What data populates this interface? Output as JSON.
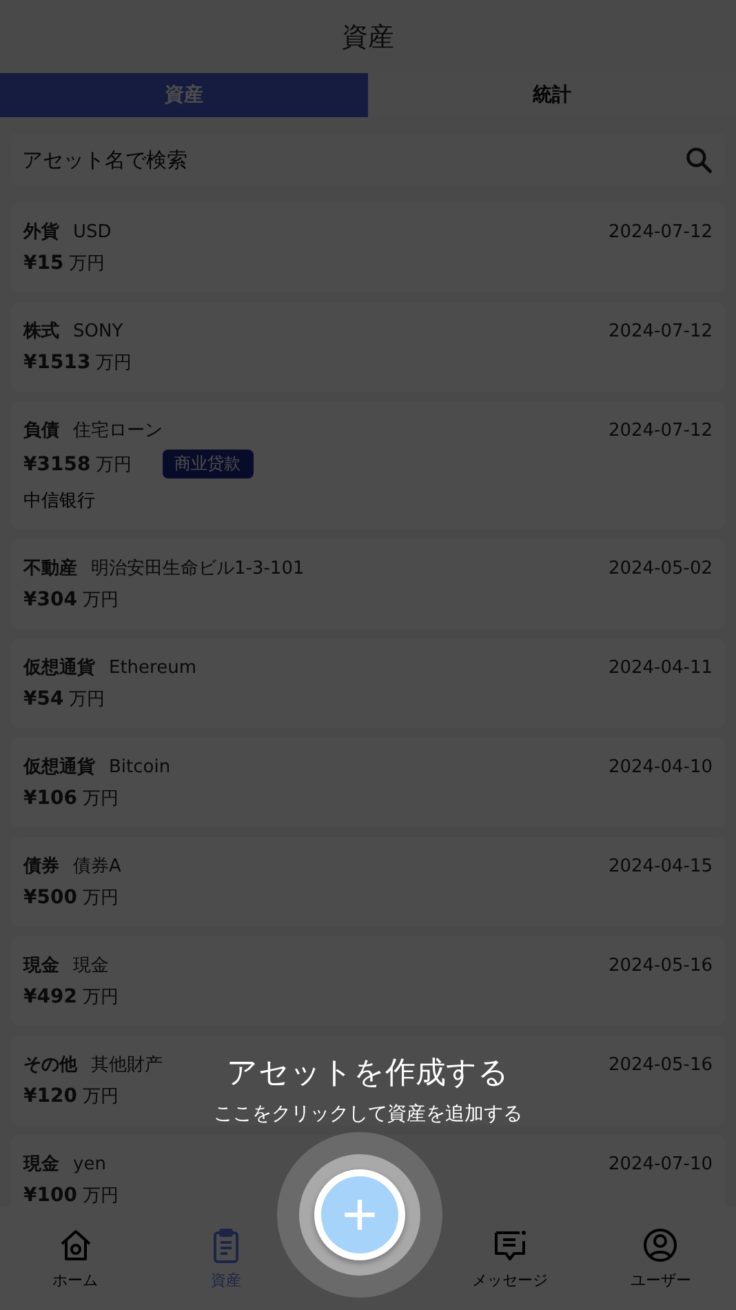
{
  "header": {
    "title": "資産"
  },
  "tabs": [
    {
      "label": "資産",
      "selected": true
    },
    {
      "label": "統計",
      "selected": false
    }
  ],
  "search": {
    "placeholder": "アセット名で検索"
  },
  "assets": [
    {
      "type": "外貨",
      "name": "USD",
      "amount": "¥15",
      "unit": "万円",
      "date": "2024-07-12"
    },
    {
      "type": "株式",
      "name": "SONY",
      "amount": "¥1513",
      "unit": "万円",
      "date": "2024-07-12"
    },
    {
      "type": "負債",
      "name": "住宅ローン",
      "amount": "¥3158",
      "unit": "万円",
      "date": "2024-07-12",
      "tag": "商业贷款",
      "institution": "中信银行"
    },
    {
      "type": "不動産",
      "name": "明治安田生命ビル1-3-101",
      "amount": "¥304",
      "unit": "万円",
      "date": "2024-05-02"
    },
    {
      "type": "仮想通貨",
      "name": "Ethereum",
      "amount": "¥54",
      "unit": "万円",
      "date": "2024-04-11"
    },
    {
      "type": "仮想通貨",
      "name": "Bitcoin",
      "amount": "¥106",
      "unit": "万円",
      "date": "2024-04-10"
    },
    {
      "type": "債券",
      "name": "債券A",
      "amount": "¥500",
      "unit": "万円",
      "date": "2024-04-15"
    },
    {
      "type": "現金",
      "name": "現金",
      "amount": "¥492",
      "unit": "万円",
      "date": "2024-05-16"
    },
    {
      "type": "その他",
      "name": "其他財产",
      "amount": "¥120",
      "unit": "万円",
      "date": "2024-05-16"
    },
    {
      "type": "現金",
      "name": "yen",
      "amount": "¥100",
      "unit": "万円",
      "date": "2024-07-10"
    }
  ],
  "bottom_nav": [
    {
      "kind": "home",
      "label": "ホーム",
      "selected": false
    },
    {
      "kind": "assets",
      "label": "資産",
      "selected": true
    },
    {
      "kind": "add"
    },
    {
      "kind": "messages",
      "label": "メッセージ",
      "selected": false
    },
    {
      "kind": "user",
      "label": "ユーザー",
      "selected": false
    }
  ],
  "coach_mark": {
    "title": "アセットを作成する",
    "subtitle": "ここをクリックして資産を追加する"
  }
}
